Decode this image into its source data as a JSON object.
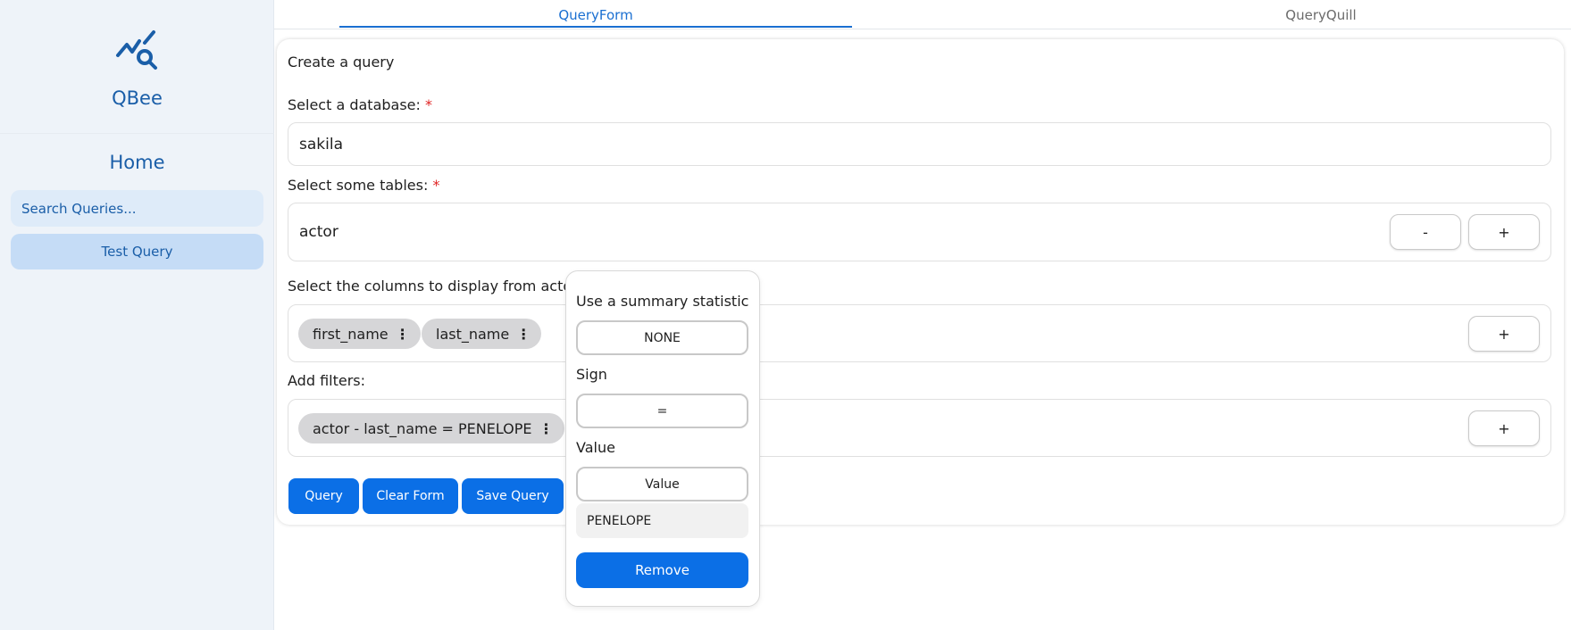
{
  "app": {
    "brand": "QBee",
    "logo_icon": "chart-search-icon"
  },
  "sidebar": {
    "home_label": "Home",
    "search_placeholder": "Search Queries...",
    "items": [
      {
        "label": "Test Query"
      }
    ]
  },
  "tabs": [
    {
      "label": "QueryForm",
      "active": true
    },
    {
      "label": "QueryQuill",
      "active": false
    }
  ],
  "form": {
    "title": "Create a query",
    "database": {
      "label": "Select a database:",
      "required_mark": "*",
      "value": "sakila"
    },
    "tables": {
      "label": "Select some tables:",
      "required_mark": "*",
      "value": "actor",
      "remove_label": "-",
      "add_label": "+"
    },
    "columns": {
      "label": "Select the columns to display from acto",
      "chips": [
        {
          "label": "first_name",
          "menu_glyph": "⋮"
        },
        {
          "label": "last_name",
          "menu_glyph": "⋮"
        }
      ],
      "add_label": "+"
    },
    "filters": {
      "label": "Add filters:",
      "chips": [
        {
          "label": "actor - last_name = PENELOPE",
          "menu_glyph": "⋮"
        }
      ],
      "add_label": "+"
    },
    "actions": {
      "query_label": "Query",
      "clear_label": "Clear Form",
      "save_label": "Save Query"
    }
  },
  "popover": {
    "summary_label": "Use a summary statistic",
    "summary_value": "NONE",
    "sign_label": "Sign",
    "sign_value": "=",
    "value_label": "Value",
    "value_button": "Value",
    "value_input": "PENELOPE",
    "remove_label": "Remove"
  },
  "colors": {
    "accent": "#0b6fe6",
    "brand": "#1a5ea8",
    "sidebar_bg": "#eef3f9",
    "required": "#e02424"
  }
}
